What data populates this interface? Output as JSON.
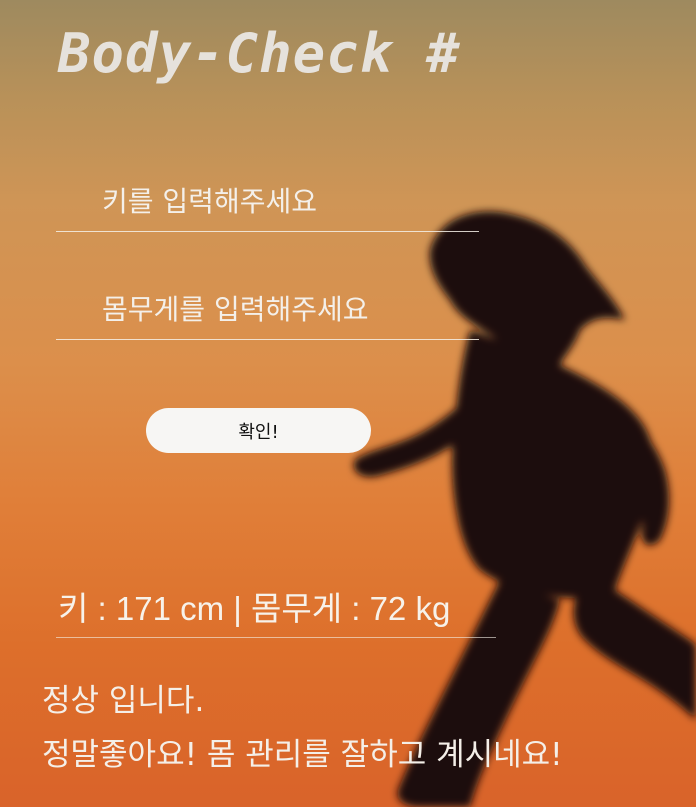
{
  "app": {
    "title": "Body-Check #"
  },
  "form": {
    "height_placeholder": "키를 입력해주세요",
    "weight_placeholder": "몸무게를 입력해주세요",
    "confirm_label": "확인!"
  },
  "result": {
    "summary": "키 : 171 cm | 몸무게 : 72 kg",
    "status_line1": "정상 입니다.",
    "status_line2": "정말좋아요! 몸 관리를 잘하고 계시네요!"
  },
  "background": {
    "image_subject": "runner-silhouette-sunset",
    "gradient_top": "#9e8a5f",
    "gradient_bottom": "#d9632a"
  }
}
